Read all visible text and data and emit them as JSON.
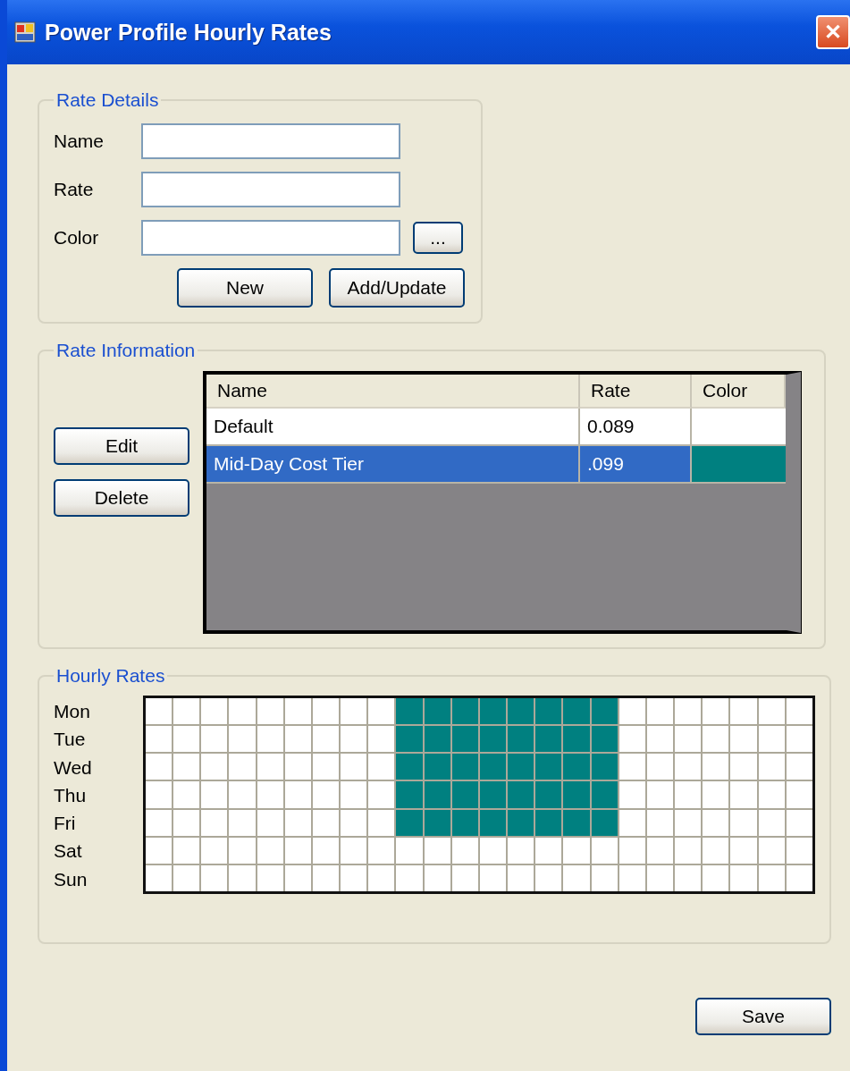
{
  "window": {
    "title": "Power Profile Hourly Rates",
    "close": "✕"
  },
  "rate_details": {
    "title": "Rate Details",
    "fields": [
      {
        "label": "Name"
      },
      {
        "label": "Rate"
      },
      {
        "label": "Color",
        "browse": "..."
      }
    ],
    "buttons": [
      "New",
      "Add/Update"
    ]
  },
  "rate_information": {
    "title": "Rate Information",
    "buttons": [
      "Edit",
      "Delete"
    ],
    "table": {
      "columns": [
        "Name",
        "Rate",
        "Color"
      ],
      "rows": [
        {
          "name": "Default",
          "rate": "0.089",
          "color": "#ffffff",
          "selected": false
        },
        {
          "name": "Mid-Day Cost Tier",
          "rate": ".099",
          "color": "#008080",
          "selected": true
        }
      ]
    }
  },
  "hourly_rates": {
    "title": "Hourly Rates",
    "days": [
      {
        "day": "Mon",
        "cells": [
          {
            "color": "#ffffff"
          },
          {
            "color": "#ffffff"
          },
          {
            "color": "#ffffff"
          },
          {
            "color": "#ffffff"
          },
          {
            "color": "#ffffff"
          },
          {
            "color": "#ffffff"
          },
          {
            "color": "#ffffff"
          },
          {
            "color": "#ffffff"
          },
          {
            "color": "#ffffff"
          },
          {
            "color": "#008080"
          },
          {
            "color": "#008080"
          },
          {
            "color": "#008080"
          },
          {
            "color": "#008080"
          },
          {
            "color": "#008080"
          },
          {
            "color": "#008080"
          },
          {
            "color": "#008080"
          },
          {
            "color": "#008080"
          },
          {
            "color": "#ffffff"
          },
          {
            "color": "#ffffff"
          },
          {
            "color": "#ffffff"
          },
          {
            "color": "#ffffff"
          },
          {
            "color": "#ffffff"
          },
          {
            "color": "#ffffff"
          },
          {
            "color": "#ffffff"
          }
        ]
      },
      {
        "day": "Tue",
        "cells": [
          {
            "color": "#ffffff"
          },
          {
            "color": "#ffffff"
          },
          {
            "color": "#ffffff"
          },
          {
            "color": "#ffffff"
          },
          {
            "color": "#ffffff"
          },
          {
            "color": "#ffffff"
          },
          {
            "color": "#ffffff"
          },
          {
            "color": "#ffffff"
          },
          {
            "color": "#ffffff"
          },
          {
            "color": "#008080"
          },
          {
            "color": "#008080"
          },
          {
            "color": "#008080"
          },
          {
            "color": "#008080"
          },
          {
            "color": "#008080"
          },
          {
            "color": "#008080"
          },
          {
            "color": "#008080"
          },
          {
            "color": "#008080"
          },
          {
            "color": "#ffffff"
          },
          {
            "color": "#ffffff"
          },
          {
            "color": "#ffffff"
          },
          {
            "color": "#ffffff"
          },
          {
            "color": "#ffffff"
          },
          {
            "color": "#ffffff"
          },
          {
            "color": "#ffffff"
          }
        ]
      },
      {
        "day": "Wed",
        "cells": [
          {
            "color": "#ffffff"
          },
          {
            "color": "#ffffff"
          },
          {
            "color": "#ffffff"
          },
          {
            "color": "#ffffff"
          },
          {
            "color": "#ffffff"
          },
          {
            "color": "#ffffff"
          },
          {
            "color": "#ffffff"
          },
          {
            "color": "#ffffff"
          },
          {
            "color": "#ffffff"
          },
          {
            "color": "#008080"
          },
          {
            "color": "#008080"
          },
          {
            "color": "#008080"
          },
          {
            "color": "#008080"
          },
          {
            "color": "#008080"
          },
          {
            "color": "#008080"
          },
          {
            "color": "#008080"
          },
          {
            "color": "#008080"
          },
          {
            "color": "#ffffff"
          },
          {
            "color": "#ffffff"
          },
          {
            "color": "#ffffff"
          },
          {
            "color": "#ffffff"
          },
          {
            "color": "#ffffff"
          },
          {
            "color": "#ffffff"
          },
          {
            "color": "#ffffff"
          }
        ]
      },
      {
        "day": "Thu",
        "cells": [
          {
            "color": "#ffffff"
          },
          {
            "color": "#ffffff"
          },
          {
            "color": "#ffffff"
          },
          {
            "color": "#ffffff"
          },
          {
            "color": "#ffffff"
          },
          {
            "color": "#ffffff"
          },
          {
            "color": "#ffffff"
          },
          {
            "color": "#ffffff"
          },
          {
            "color": "#ffffff"
          },
          {
            "color": "#008080"
          },
          {
            "color": "#008080"
          },
          {
            "color": "#008080"
          },
          {
            "color": "#008080"
          },
          {
            "color": "#008080"
          },
          {
            "color": "#008080"
          },
          {
            "color": "#008080"
          },
          {
            "color": "#008080"
          },
          {
            "color": "#ffffff"
          },
          {
            "color": "#ffffff"
          },
          {
            "color": "#ffffff"
          },
          {
            "color": "#ffffff"
          },
          {
            "color": "#ffffff"
          },
          {
            "color": "#ffffff"
          },
          {
            "color": "#ffffff"
          }
        ]
      },
      {
        "day": "Fri",
        "cells": [
          {
            "color": "#ffffff"
          },
          {
            "color": "#ffffff"
          },
          {
            "color": "#ffffff"
          },
          {
            "color": "#ffffff"
          },
          {
            "color": "#ffffff"
          },
          {
            "color": "#ffffff"
          },
          {
            "color": "#ffffff"
          },
          {
            "color": "#ffffff"
          },
          {
            "color": "#ffffff"
          },
          {
            "color": "#008080"
          },
          {
            "color": "#008080"
          },
          {
            "color": "#008080"
          },
          {
            "color": "#008080"
          },
          {
            "color": "#008080"
          },
          {
            "color": "#008080"
          },
          {
            "color": "#008080"
          },
          {
            "color": "#008080"
          },
          {
            "color": "#ffffff"
          },
          {
            "color": "#ffffff"
          },
          {
            "color": "#ffffff"
          },
          {
            "color": "#ffffff"
          },
          {
            "color": "#ffffff"
          },
          {
            "color": "#ffffff"
          },
          {
            "color": "#ffffff"
          }
        ]
      },
      {
        "day": "Sat",
        "cells": [
          {
            "color": "#ffffff"
          },
          {
            "color": "#ffffff"
          },
          {
            "color": "#ffffff"
          },
          {
            "color": "#ffffff"
          },
          {
            "color": "#ffffff"
          },
          {
            "color": "#ffffff"
          },
          {
            "color": "#ffffff"
          },
          {
            "color": "#ffffff"
          },
          {
            "color": "#ffffff"
          },
          {
            "color": "#ffffff"
          },
          {
            "color": "#ffffff"
          },
          {
            "color": "#ffffff"
          },
          {
            "color": "#ffffff"
          },
          {
            "color": "#ffffff"
          },
          {
            "color": "#ffffff"
          },
          {
            "color": "#ffffff"
          },
          {
            "color": "#ffffff"
          },
          {
            "color": "#ffffff"
          },
          {
            "color": "#ffffff"
          },
          {
            "color": "#ffffff"
          },
          {
            "color": "#ffffff"
          },
          {
            "color": "#ffffff"
          },
          {
            "color": "#ffffff"
          },
          {
            "color": "#ffffff"
          }
        ]
      },
      {
        "day": "Sun",
        "cells": [
          {
            "color": "#ffffff"
          },
          {
            "color": "#ffffff"
          },
          {
            "color": "#ffffff"
          },
          {
            "color": "#ffffff"
          },
          {
            "color": "#ffffff"
          },
          {
            "color": "#ffffff"
          },
          {
            "color": "#ffffff"
          },
          {
            "color": "#ffffff"
          },
          {
            "color": "#ffffff"
          },
          {
            "color": "#ffffff"
          },
          {
            "color": "#ffffff"
          },
          {
            "color": "#ffffff"
          },
          {
            "color": "#ffffff"
          },
          {
            "color": "#ffffff"
          },
          {
            "color": "#ffffff"
          },
          {
            "color": "#ffffff"
          },
          {
            "color": "#ffffff"
          },
          {
            "color": "#ffffff"
          },
          {
            "color": "#ffffff"
          },
          {
            "color": "#ffffff"
          },
          {
            "color": "#ffffff"
          },
          {
            "color": "#ffffff"
          },
          {
            "color": "#ffffff"
          },
          {
            "color": "#ffffff"
          }
        ]
      }
    ]
  },
  "save_button": "Save"
}
